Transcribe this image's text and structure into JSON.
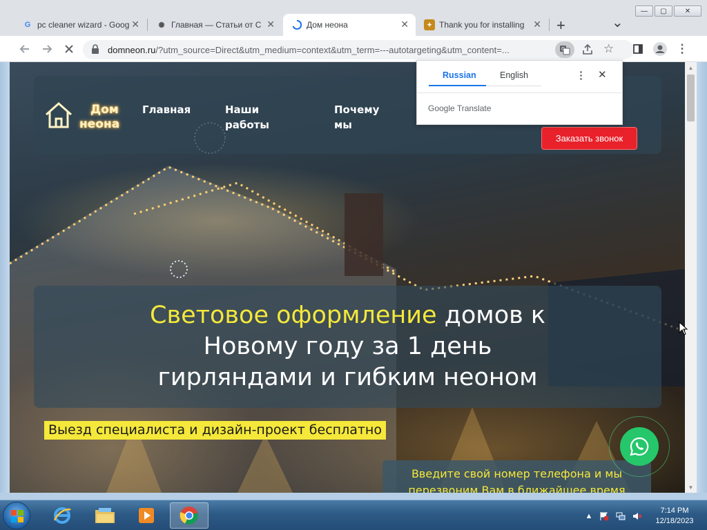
{
  "browser": {
    "tabs": [
      {
        "title": "pc cleaner wizard - Goog",
        "favicon": "google-icon",
        "active": false
      },
      {
        "title": "Главная — Статьи от С",
        "favicon": "openai-icon",
        "active": false
      },
      {
        "title": "Дом неона",
        "favicon": "loading-spinner-icon",
        "active": true
      },
      {
        "title": "Thank you for installing",
        "favicon": "extension-icon",
        "active": false
      }
    ],
    "new_tab_symbol": "+",
    "tab_list_symbol": "⌄",
    "url_domain": "domneon.ru",
    "url_rest": "/?utm_source=Direct&utm_medium=context&utm_term=---autotargeting&utm_content=...",
    "window_buttons": [
      "—",
      "▢",
      "✕"
    ]
  },
  "translate_popup": {
    "source_lang": "Russian",
    "target_lang": "English",
    "brand": "Google Translate",
    "menu_symbol": "⋮",
    "close_symbol": "✕"
  },
  "site": {
    "logo_line1": "Дом",
    "logo_line2": "неона",
    "nav": [
      {
        "line1": "Главная",
        "line2": ""
      },
      {
        "line1": "Наши",
        "line2": "работы"
      },
      {
        "line1": "Почему",
        "line2": "мы"
      }
    ],
    "call_button": "Заказать звонок",
    "hero_highlight": "Световое оформление",
    "hero_line1_rest": " домов к",
    "hero_line2": "Новому году за 1 день",
    "hero_line3": "гирляндами и гибким неоном",
    "subtitle": "Выезд специалиста и дизайн-проект бесплатно",
    "phone_line1": "Введите свой номер телефона и мы",
    "phone_line2": "перезвоним Вам в ближайшее время"
  },
  "taskbar": {
    "time": "7:14 PM",
    "date": "12/18/2023",
    "apps": [
      "internet-explorer-icon",
      "file-explorer-icon",
      "media-player-icon",
      "chrome-icon"
    ],
    "show_hidden_symbol": "▲"
  },
  "colors": {
    "accent_yellow": "#f5e83a",
    "cta_red": "#e8212a",
    "whatsapp_green": "#25c76a",
    "chrome_blue": "#1a73e8"
  }
}
